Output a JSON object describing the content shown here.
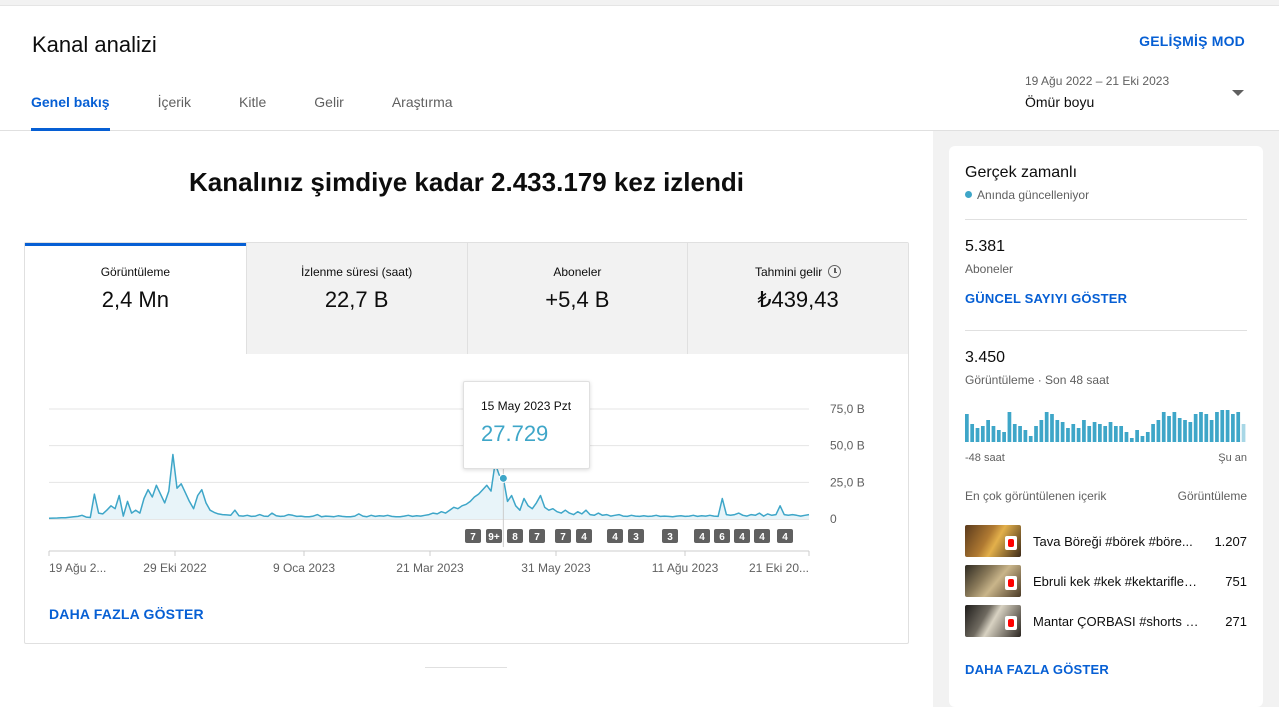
{
  "header": {
    "title": "Kanal analizi",
    "advanced_mode": "GELİŞMİŞ MOD",
    "tabs": [
      {
        "label": "Genel bakış",
        "active": true
      },
      {
        "label": "İçerik",
        "active": false
      },
      {
        "label": "Kitle",
        "active": false
      },
      {
        "label": "Gelir",
        "active": false
      },
      {
        "label": "Araştırma",
        "active": false
      }
    ],
    "date_range": "19 Ağu 2022 – 21 Eki 2023",
    "date_value": "Ömür boyu"
  },
  "overview": {
    "headline": "Kanalınız şimdiye kadar 2.433.179 kez izlendi",
    "metrics": [
      {
        "label": "Görüntüleme",
        "value": "2,4 Mn"
      },
      {
        "label": "İzlenme süresi (saat)",
        "value": "22,7 B"
      },
      {
        "label": "Aboneler",
        "value": "+5,4 B"
      },
      {
        "label": "Tahmini gelir",
        "value": "₺439,43"
      }
    ],
    "tooltip": {
      "date": "15 May 2023 Pzt",
      "value": "27.729"
    },
    "show_more": "DAHA FAZLA GÖSTER"
  },
  "chart_data": {
    "type": "area",
    "title": "",
    "xlabel": "",
    "ylabel": "",
    "x_tick_labels": [
      "19 Ağu 2...",
      "29 Eki 2022",
      "9 Oca 2023",
      "21 Mar 2023",
      "31 May 2023",
      "11 Ağu 2023",
      "21 Eki 20..."
    ],
    "y_tick_labels": [
      "0",
      "25,0 B",
      "50,0 B",
      "75,0 B"
    ],
    "ylim": [
      0,
      75000
    ],
    "grid": true,
    "series": [
      {
        "values": [
          500,
          600,
          700,
          900,
          800,
          1200,
          1500,
          1800,
          2500,
          1300,
          1000,
          17000,
          4000,
          3500,
          6000,
          9000,
          7000,
          16000,
          2000,
          12000,
          4000,
          6000,
          4000,
          14000,
          20000,
          15000,
          23000,
          17000,
          11000,
          19000,
          44000,
          21000,
          24000,
          18000,
          12000,
          7000,
          16000,
          20000,
          11000,
          6000,
          4500,
          3500,
          3000,
          2800,
          2500,
          6000,
          2200,
          2000,
          2500,
          1800,
          2000,
          3000,
          2000,
          1800,
          4000,
          2200,
          1800,
          2000,
          3000,
          2500,
          1800,
          2000,
          1500,
          1600,
          2000,
          3000,
          1500,
          2000,
          1800,
          1600,
          2200,
          1800,
          1500,
          1600,
          2000,
          3500,
          2000,
          1600,
          2500,
          1800,
          2200,
          2000,
          2500,
          1800,
          1500,
          1600,
          2000,
          2500,
          1800,
          2200,
          2000,
          2500,
          3000,
          4000,
          3500,
          5000,
          4000,
          6000,
          8000,
          7000,
          9000,
          10000,
          12000,
          15000,
          17000,
          20000,
          23000,
          19000,
          38000,
          30000,
          27729,
          12000,
          16000,
          9000,
          6000,
          14000,
          9000,
          7000,
          11000,
          16000,
          8000,
          6000,
          7000,
          5000,
          4000,
          6000,
          4000,
          3000,
          5000,
          3500,
          6000,
          3000,
          2500,
          4000,
          2500,
          3000,
          2000,
          2500,
          3000,
          2000,
          1800,
          2500,
          2000,
          1800,
          2200,
          1800,
          2000,
          2500,
          1800,
          2000,
          1800,
          1500,
          2000,
          2200,
          1800,
          2000,
          2500,
          1800,
          2200,
          2000,
          2500,
          2000,
          1800,
          14000,
          3000,
          2500,
          3000,
          4000,
          2500,
          2000,
          3000,
          2500,
          4000,
          2000,
          3500,
          2500,
          3000,
          9000,
          3000,
          2500,
          3000,
          2500,
          2000,
          2500,
          3000
        ]
      }
    ],
    "events": [
      "7",
      "9+",
      "8",
      "7",
      "7",
      "4",
      "4",
      "3",
      "3",
      "4",
      "6",
      "4",
      "4",
      "4"
    ],
    "highlight_value": 27729
  },
  "realtime": {
    "title": "Gerçek zamanlı",
    "subtitle": "Anında güncelleniyor",
    "subscribers_value": "5.381",
    "subscribers_label": "Aboneler",
    "show_count": "GÜNCEL SAYIYI GÖSTER",
    "views_value": "3.450",
    "views_label": "Görüntüleme · Son 48 saat",
    "axis_left": "-48 saat",
    "axis_right": "Şu an",
    "bars": [
      28,
      18,
      14,
      16,
      22,
      16,
      12,
      10,
      30,
      18,
      16,
      12,
      6,
      16,
      22,
      30,
      28,
      22,
      20,
      14,
      18,
      14,
      22,
      16,
      20,
      18,
      16,
      20,
      16,
      16,
      10,
      4,
      12,
      6,
      10,
      18,
      22,
      30,
      26,
      30,
      24,
      22,
      20,
      28,
      30,
      28,
      22,
      30,
      32,
      32,
      28,
      30,
      18
    ],
    "top_content_label": "En çok görüntülenen içerik",
    "top_content_views_label": "Görüntüleme",
    "top_content": [
      {
        "title": "Tava Böreği #börek #böre...",
        "views": "1.207"
      },
      {
        "title": "Ebruli kek #kek #kektarifleri...",
        "views": "751"
      },
      {
        "title": "Mantar ÇORBASI #shorts #...",
        "views": "271"
      }
    ],
    "show_more": "DAHA FAZLA GÖSTER"
  },
  "colors": {
    "accent": "#065fd4",
    "chart_line": "#3ea6c8"
  }
}
